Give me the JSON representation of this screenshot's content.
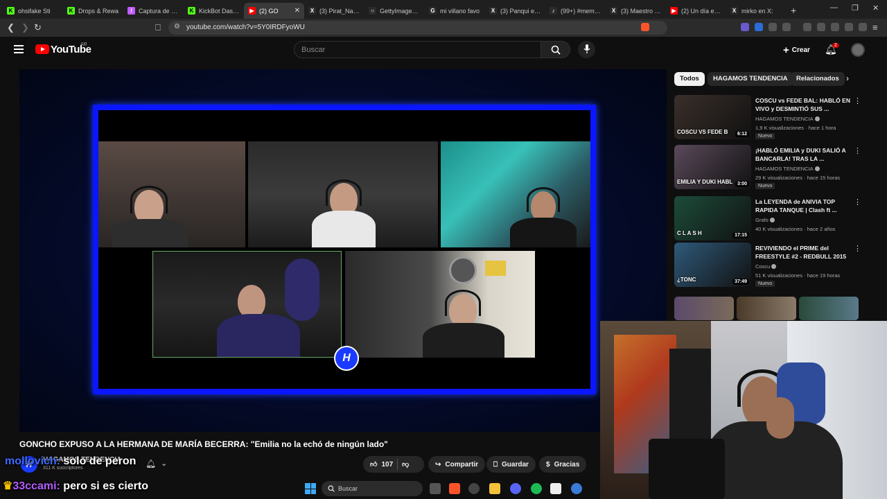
{
  "browser": {
    "tabs": [
      {
        "title": "ohsifake Sti",
        "fav_color": "#53fc18",
        "fav_glyph": "K"
      },
      {
        "title": "Drops & Rewa",
        "fav_color": "#53fc18",
        "fav_glyph": "K"
      },
      {
        "title": "Captura de pan",
        "fav_color": "#c25cff",
        "fav_glyph": "/"
      },
      {
        "title": "KickBot Dashbo",
        "fav_color": "#53fc18",
        "fav_glyph": "K"
      },
      {
        "title": "(2) GO",
        "fav_color": "#ff0000",
        "fav_glyph": "▶"
      },
      {
        "title": "(3) Pirat_Nation",
        "fav_color": "#2b2b2b",
        "fav_glyph": "X"
      },
      {
        "title": "GettyImages-1",
        "fav_color": "#2b2b2b",
        "fav_glyph": "○"
      },
      {
        "title": "mi villano favo",
        "fav_color": "#2b2b2b",
        "fav_glyph": "G"
      },
      {
        "title": "(3) Panqui en X",
        "fav_color": "#2b2b2b",
        "fav_glyph": "X"
      },
      {
        "title": "(99+) #meme #",
        "fav_color": "#2b2b2b",
        "fav_glyph": "♪"
      },
      {
        "title": "(3) Maestro Spl",
        "fav_color": "#2b2b2b",
        "fav_glyph": "X"
      },
      {
        "title": "(2) Un día en la",
        "fav_color": "#ff0000",
        "fav_glyph": "▶"
      },
      {
        "title": "mirko en X:",
        "fav_color": "#2b2b2b",
        "fav_glyph": "X"
      }
    ],
    "active_tab_index": 4,
    "new_tab_label": "+",
    "url": "youtube.com/watch?v=5Y0IRDFyoWU"
  },
  "youtube": {
    "logo_text": "YouTube",
    "country": "AR",
    "search_placeholder": "Buscar",
    "create_label": "Crear",
    "notif_count": "2"
  },
  "video": {
    "title": "GONCHO EXPUSO A LA HERMANA DE MARÍA BECERRA: \"Emilia no la echó de ningún lado\"",
    "channel": "HAGAMOS TENDENCIA",
    "channel_avatar": "H",
    "subscribers": "311 K suscriptores",
    "likes": "107",
    "share_label": "Compartir",
    "save_label": "Guardar",
    "thanks_label": "Gracias",
    "overlay_logo": "H"
  },
  "chat": [
    {
      "user": "mollovich:",
      "message": " solo de peron",
      "user_color": "#3d6bff"
    },
    {
      "user": "33ccami:",
      "message": " pero si es cierto",
      "user_color": "#b45cff"
    }
  ],
  "sidebar": {
    "chips": [
      "Todos",
      "HAGAMOS TENDENCIA",
      "Relacionados"
    ],
    "recommendations": [
      {
        "title": "COSCU vs FEDE BAL: HABLÓ EN VIVO y DESMINTIÓ SUS ...",
        "channel": "HAGAMOS TENDENCIA",
        "verified": true,
        "meta": "1,9 K visualizaciones · hace 1 hora",
        "badge": "Nuevo",
        "duration": "6:12",
        "thumb_caption": "COSCU VS FEDE B",
        "thumb_color": "#3a2f2a"
      },
      {
        "title": "¡HABLÓ EMILIA y DUKI SALIÓ A BANCARLA! TRAS LA ...",
        "channel": "HAGAMOS TENDENCIA",
        "verified": true,
        "meta": "29 K visualizaciones · hace 15 horas",
        "badge": "Nuevo",
        "duration": "3:00",
        "thumb_caption": "EMILIA Y DUKI HABL",
        "thumb_color": "#5a4a5a"
      },
      {
        "title": "La LEYENDA de ANIVIA TOP RAPIDA TANQUE | Clash ft ...",
        "channel": "Grafo",
        "verified": true,
        "meta": "40 K visualizaciones · hace 2 años",
        "badge": "",
        "duration": "17:15",
        "thumb_caption": "C L A S H",
        "thumb_color": "#1c4c3a"
      },
      {
        "title": "REVIVIENDO el PRIME del FREESTYLE #2 - REDBULL 2015",
        "channel": "Coscu",
        "verified": true,
        "meta": "51 K visualizaciones · hace 19 horas",
        "badge": "Nuevo",
        "duration": "37:49",
        "thumb_caption": "¿TONC",
        "thumb_color": "#2f5a7a"
      }
    ]
  },
  "taskbar": {
    "search_label": "Buscar"
  }
}
